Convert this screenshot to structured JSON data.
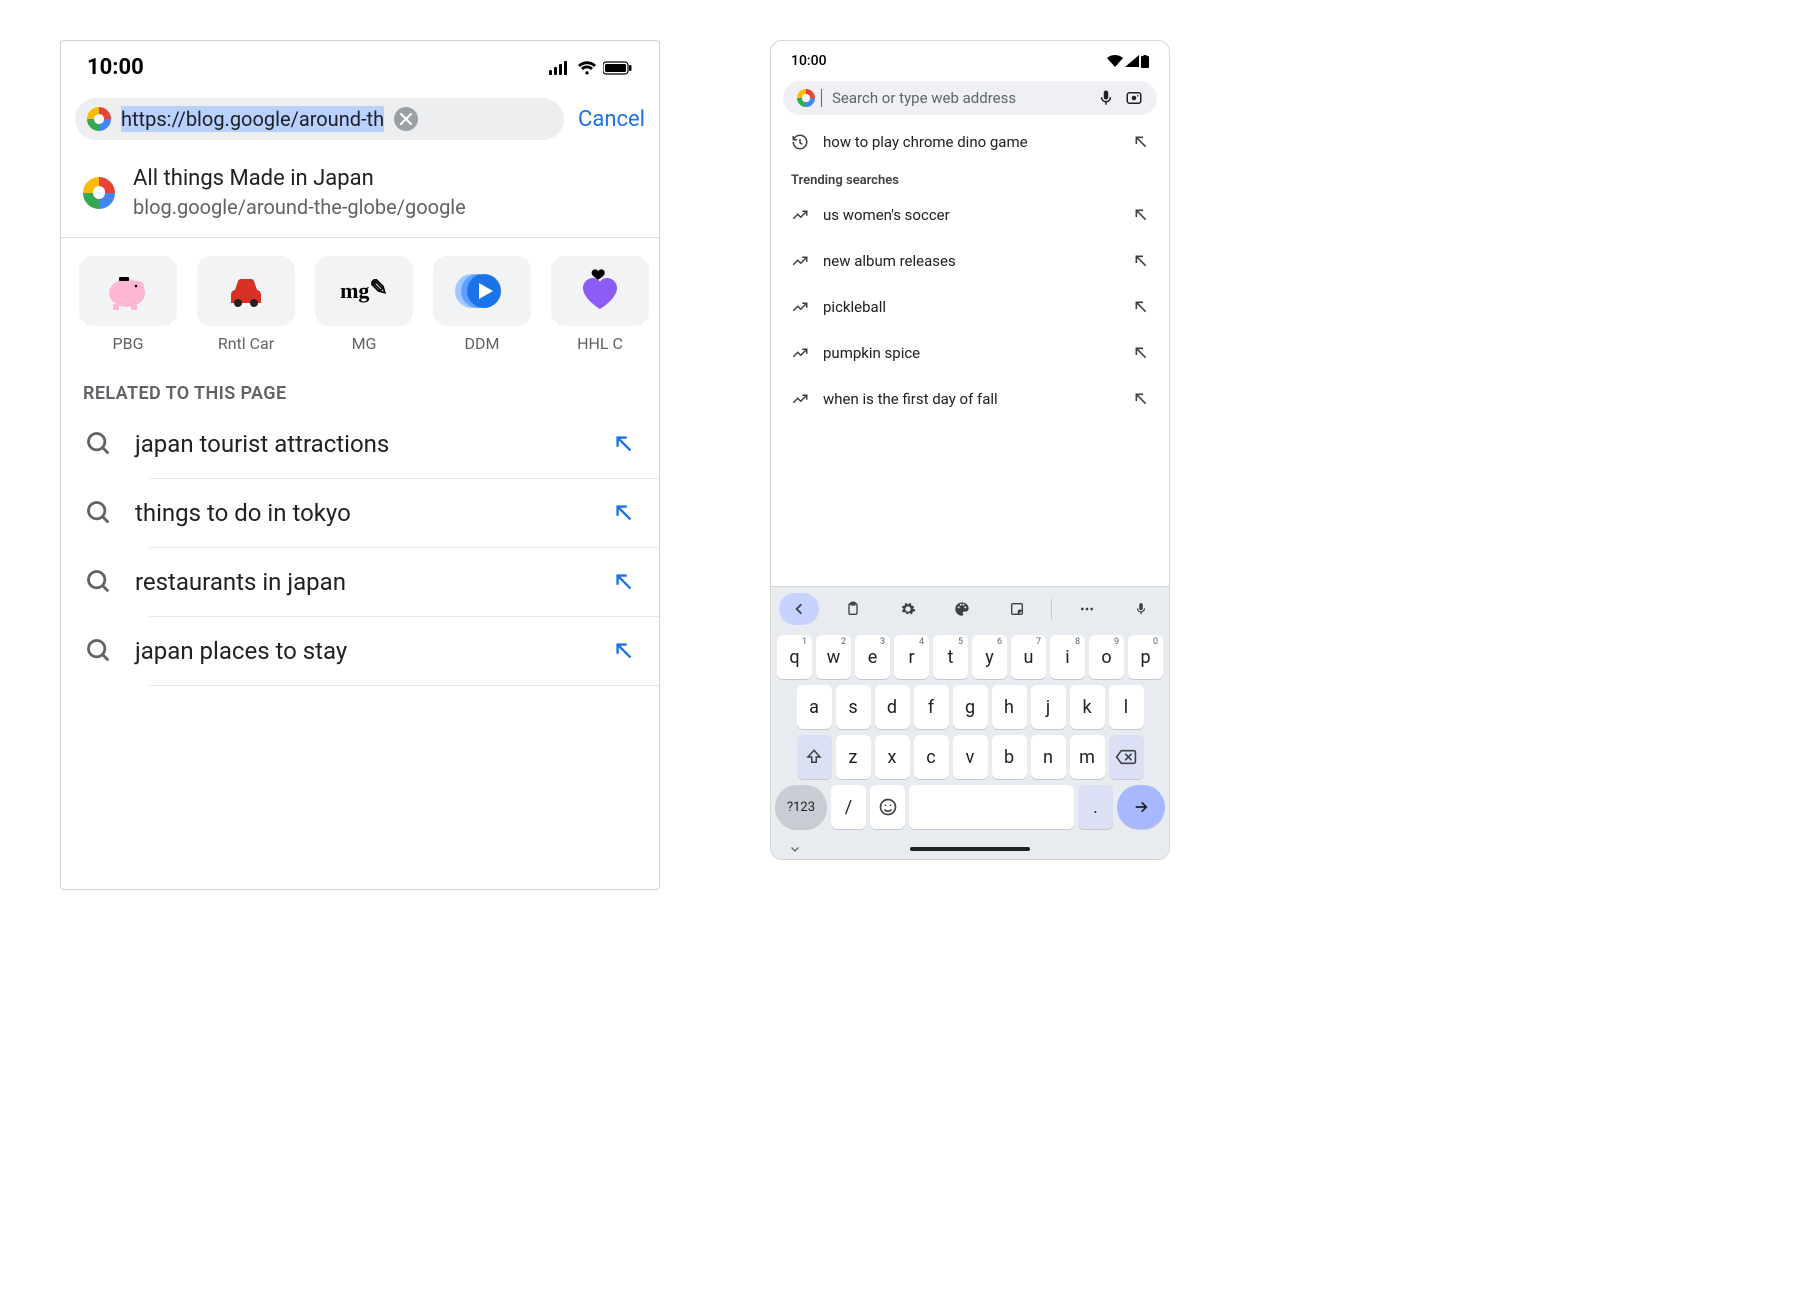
{
  "ios": {
    "status_time": "10:00",
    "url_value": "https://blog.google/around-th",
    "cancel_label": "Cancel",
    "top_result": {
      "title": "All things Made in Japan",
      "subtitle": "blog.google/around-the-globe/google"
    },
    "shortcuts": [
      {
        "label": "PBG",
        "icon": "piggy"
      },
      {
        "label": "Rntl Car",
        "icon": "car"
      },
      {
        "label": "MG",
        "icon": "mg"
      },
      {
        "label": "DDM",
        "icon": "play"
      },
      {
        "label": "HHL C",
        "icon": "heart"
      }
    ],
    "related_header": "RELATED TO THIS PAGE",
    "related_items": [
      "japan tourist attractions",
      "things to do in tokyo",
      "restaurants in japan",
      "japan places to stay"
    ]
  },
  "android": {
    "status_time": "10:00",
    "search_placeholder": "Search or type web address",
    "recent_query": "how to play chrome dino game",
    "trending_header": "Trending searches",
    "trending_items": [
      "us women's soccer",
      "new album releases",
      "pickleball",
      "pumpkin spice",
      "when is the first day of fall"
    ],
    "keyboard": {
      "row1": [
        {
          "k": "q",
          "n": "1"
        },
        {
          "k": "w",
          "n": "2"
        },
        {
          "k": "e",
          "n": "3"
        },
        {
          "k": "r",
          "n": "4"
        },
        {
          "k": "t",
          "n": "5"
        },
        {
          "k": "y",
          "n": "6"
        },
        {
          "k": "u",
          "n": "7"
        },
        {
          "k": "i",
          "n": "8"
        },
        {
          "k": "o",
          "n": "9"
        },
        {
          "k": "p",
          "n": "0"
        }
      ],
      "row2": [
        "a",
        "s",
        "d",
        "f",
        "g",
        "h",
        "j",
        "k",
        "l"
      ],
      "row3": [
        "z",
        "x",
        "c",
        "v",
        "b",
        "n",
        "m"
      ],
      "mode_key": "?123",
      "slash_key": "/",
      "dot_key": "."
    }
  }
}
